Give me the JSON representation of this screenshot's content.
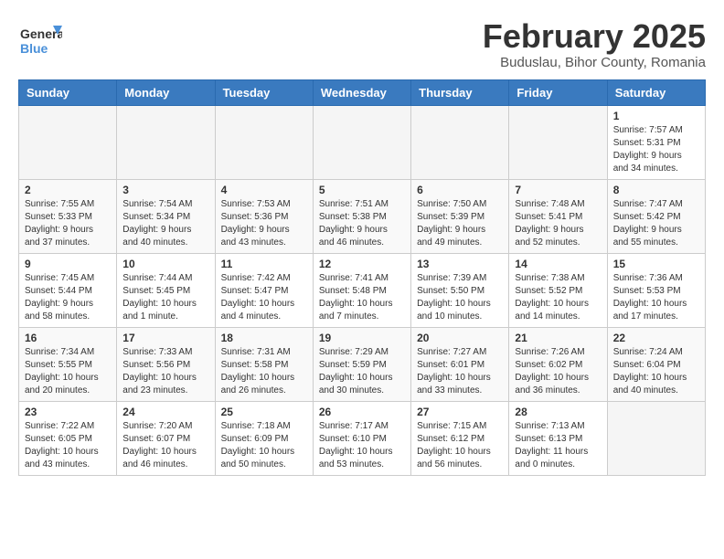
{
  "header": {
    "logo_general": "General",
    "logo_blue": "Blue",
    "title": "February 2025",
    "subtitle": "Buduslau, Bihor County, Romania"
  },
  "days_of_week": [
    "Sunday",
    "Monday",
    "Tuesday",
    "Wednesday",
    "Thursday",
    "Friday",
    "Saturday"
  ],
  "weeks": [
    [
      {
        "day": "",
        "info": ""
      },
      {
        "day": "",
        "info": ""
      },
      {
        "day": "",
        "info": ""
      },
      {
        "day": "",
        "info": ""
      },
      {
        "day": "",
        "info": ""
      },
      {
        "day": "",
        "info": ""
      },
      {
        "day": "1",
        "info": "Sunrise: 7:57 AM\nSunset: 5:31 PM\nDaylight: 9 hours and 34 minutes."
      }
    ],
    [
      {
        "day": "2",
        "info": "Sunrise: 7:55 AM\nSunset: 5:33 PM\nDaylight: 9 hours and 37 minutes."
      },
      {
        "day": "3",
        "info": "Sunrise: 7:54 AM\nSunset: 5:34 PM\nDaylight: 9 hours and 40 minutes."
      },
      {
        "day": "4",
        "info": "Sunrise: 7:53 AM\nSunset: 5:36 PM\nDaylight: 9 hours and 43 minutes."
      },
      {
        "day": "5",
        "info": "Sunrise: 7:51 AM\nSunset: 5:38 PM\nDaylight: 9 hours and 46 minutes."
      },
      {
        "day": "6",
        "info": "Sunrise: 7:50 AM\nSunset: 5:39 PM\nDaylight: 9 hours and 49 minutes."
      },
      {
        "day": "7",
        "info": "Sunrise: 7:48 AM\nSunset: 5:41 PM\nDaylight: 9 hours and 52 minutes."
      },
      {
        "day": "8",
        "info": "Sunrise: 7:47 AM\nSunset: 5:42 PM\nDaylight: 9 hours and 55 minutes."
      }
    ],
    [
      {
        "day": "9",
        "info": "Sunrise: 7:45 AM\nSunset: 5:44 PM\nDaylight: 9 hours and 58 minutes."
      },
      {
        "day": "10",
        "info": "Sunrise: 7:44 AM\nSunset: 5:45 PM\nDaylight: 10 hours and 1 minute."
      },
      {
        "day": "11",
        "info": "Sunrise: 7:42 AM\nSunset: 5:47 PM\nDaylight: 10 hours and 4 minutes."
      },
      {
        "day": "12",
        "info": "Sunrise: 7:41 AM\nSunset: 5:48 PM\nDaylight: 10 hours and 7 minutes."
      },
      {
        "day": "13",
        "info": "Sunrise: 7:39 AM\nSunset: 5:50 PM\nDaylight: 10 hours and 10 minutes."
      },
      {
        "day": "14",
        "info": "Sunrise: 7:38 AM\nSunset: 5:52 PM\nDaylight: 10 hours and 14 minutes."
      },
      {
        "day": "15",
        "info": "Sunrise: 7:36 AM\nSunset: 5:53 PM\nDaylight: 10 hours and 17 minutes."
      }
    ],
    [
      {
        "day": "16",
        "info": "Sunrise: 7:34 AM\nSunset: 5:55 PM\nDaylight: 10 hours and 20 minutes."
      },
      {
        "day": "17",
        "info": "Sunrise: 7:33 AM\nSunset: 5:56 PM\nDaylight: 10 hours and 23 minutes."
      },
      {
        "day": "18",
        "info": "Sunrise: 7:31 AM\nSunset: 5:58 PM\nDaylight: 10 hours and 26 minutes."
      },
      {
        "day": "19",
        "info": "Sunrise: 7:29 AM\nSunset: 5:59 PM\nDaylight: 10 hours and 30 minutes."
      },
      {
        "day": "20",
        "info": "Sunrise: 7:27 AM\nSunset: 6:01 PM\nDaylight: 10 hours and 33 minutes."
      },
      {
        "day": "21",
        "info": "Sunrise: 7:26 AM\nSunset: 6:02 PM\nDaylight: 10 hours and 36 minutes."
      },
      {
        "day": "22",
        "info": "Sunrise: 7:24 AM\nSunset: 6:04 PM\nDaylight: 10 hours and 40 minutes."
      }
    ],
    [
      {
        "day": "23",
        "info": "Sunrise: 7:22 AM\nSunset: 6:05 PM\nDaylight: 10 hours and 43 minutes."
      },
      {
        "day": "24",
        "info": "Sunrise: 7:20 AM\nSunset: 6:07 PM\nDaylight: 10 hours and 46 minutes."
      },
      {
        "day": "25",
        "info": "Sunrise: 7:18 AM\nSunset: 6:09 PM\nDaylight: 10 hours and 50 minutes."
      },
      {
        "day": "26",
        "info": "Sunrise: 7:17 AM\nSunset: 6:10 PM\nDaylight: 10 hours and 53 minutes."
      },
      {
        "day": "27",
        "info": "Sunrise: 7:15 AM\nSunset: 6:12 PM\nDaylight: 10 hours and 56 minutes."
      },
      {
        "day": "28",
        "info": "Sunrise: 7:13 AM\nSunset: 6:13 PM\nDaylight: 11 hours and 0 minutes."
      },
      {
        "day": "",
        "info": ""
      }
    ]
  ]
}
